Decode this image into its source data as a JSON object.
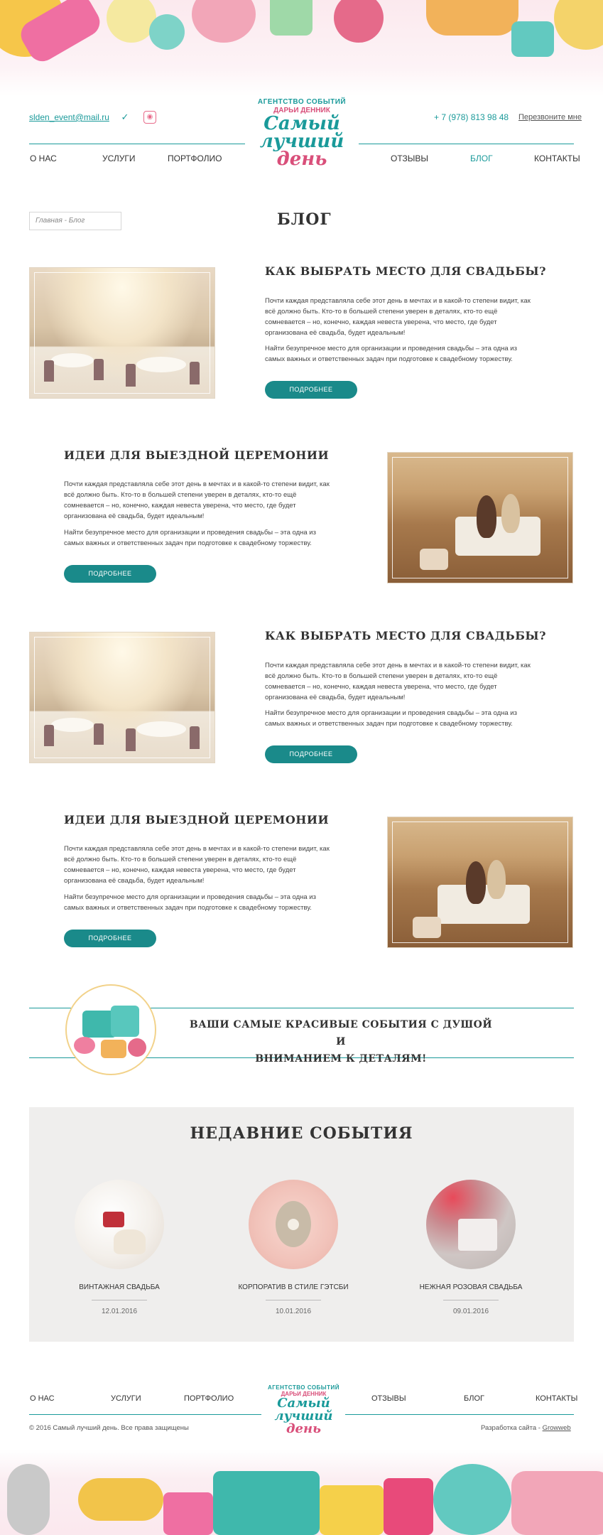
{
  "header": {
    "email": "slden_event@mail.ru",
    "social": [
      {
        "icon": "vk-icon",
        "glyph": "✓"
      },
      {
        "icon": "instagram-icon",
        "glyph": "◉"
      }
    ],
    "phone": "+ 7 (978) 813 98 48",
    "callback": "Перезвоните мне",
    "logo": {
      "line1": "АГЕНТСТВО СОБЫТИЙ",
      "line2": "ДАРЬИ ДЕННИК",
      "main1": "Самый",
      "main2": "лучший",
      "main3": "день"
    }
  },
  "nav": [
    {
      "label": "О НАС"
    },
    {
      "label": "УСЛУГИ"
    },
    {
      "label": "ПОРТФОЛИО"
    },
    {
      "label": "ОТЗЫВЫ"
    },
    {
      "label": "БЛОГ",
      "active": true
    },
    {
      "label": "КОНТАКТЫ"
    }
  ],
  "breadcrumb": "Главная - Блог",
  "page_title": "БЛОГ",
  "articles": [
    {
      "title": "КАК ВЫБРАТЬ МЕСТО ДЛЯ СВАДЬБЫ?",
      "p1": "Почти каждая представляла себе этот день в мечтах и в какой-то степени видит, как всё должно быть. Кто-то в большей степени уверен в деталях, кто-то ещё сомневается – но, конечно, каждая невеста уверена, что место, где будет организована её свадьба, будет идеальным!",
      "p2": "Найти безупречное место для организации и проведения свадьбы – эта одна из самых важных и ответственных задач при подготовке к свадебному торжеству.",
      "button": "ПОДРОБНЕЕ",
      "image": "banquet-hall"
    },
    {
      "title": "ИДЕИ ДЛЯ ВЫЕЗДНОЙ ЦЕРЕМОНИИ",
      "p1": "Почти каждая представляла себе этот день в мечтах и в какой-то степени видит, как всё должно быть. Кто-то в большей степени уверен в деталях, кто-то ещё сомневается – но, конечно, каждая невеста уверена, что место, где будет организована её свадьба, будет идеальным!",
      "p2": "Найти безупречное место для организации и проведения свадьбы – эта одна из самых важных и ответственных задач при подготовке к свадебному торжеству.",
      "button": "ПОДРОБНЕЕ",
      "image": "outdoor-ceremony"
    },
    {
      "title": "КАК ВЫБРАТЬ МЕСТО ДЛЯ СВАДЬБЫ?",
      "p1": "Почти каждая представляла себе этот день в мечтах и в какой-то степени видит, как всё должно быть. Кто-то в большей степени уверен в деталях, кто-то ещё сомневается – но, конечно, каждая невеста уверена, что место, где будет организована её свадьба, будет идеальным!",
      "p2": "Найти безупречное место для организации и проведения свадьбы – эта одна из самых важных и ответственных задач при подготовке к свадебному торжеству.",
      "button": "ПОДРОБНЕЕ",
      "image": "banquet-hall"
    },
    {
      "title": "ИДЕИ ДЛЯ ВЫЕЗДНОЙ ЦЕРЕМОНИИ",
      "p1": "Почти каждая представляла себе этот день в мечтах и в какой-то степени видит, как всё должно быть. Кто-то в большей степени уверен в деталях, кто-то ещё сомневается – но, конечно, каждая невеста уверена, что место, где будет организована её свадьба, будет идеальным!",
      "p2": "Найти безупречное место для организации и проведения свадьбы – эта одна из самых важных и ответственных задач при подготовке к свадебному торжеству.",
      "button": "ПОДРОБНЕЕ",
      "image": "outdoor-ceremony"
    }
  ],
  "slogan": {
    "line1": "ВАШИ САМЫЕ КРАСИВЫЕ СОБЫТИЯ С ДУШОЙ И",
    "line2": "ВНИМАНИЕМ К ДЕТАЛЯМ!"
  },
  "events": {
    "title": "НЕДАВНИЕ СОБЫТИЯ",
    "items": [
      {
        "name": "ВИНТАЖНАЯ СВАДЬБА",
        "date": "12.01.2016"
      },
      {
        "name": "КОРПОРАТИВ В СТИЛЕ ГЭТСБИ",
        "date": "10.01.2016"
      },
      {
        "name": "НЕЖНАЯ РОЗОВАЯ СВАДЬБА",
        "date": "09.01.2016"
      }
    ]
  },
  "footer": {
    "nav": [
      "О НАС",
      "УСЛУГИ",
      "ПОРТФОЛИО",
      "ОТЗЫВЫ",
      "БЛОГ",
      "КОНТАКТЫ"
    ],
    "copyright": "©  2016  Самый лучший день.  Все права защищены",
    "dev_prefix": "Разработка сайта - ",
    "dev_link": "Growweb"
  },
  "colors": {
    "accent": "#1a9a9a",
    "button": "#1a8a8a",
    "pink": "#d94f7a",
    "events_bg": "#efeeed"
  }
}
